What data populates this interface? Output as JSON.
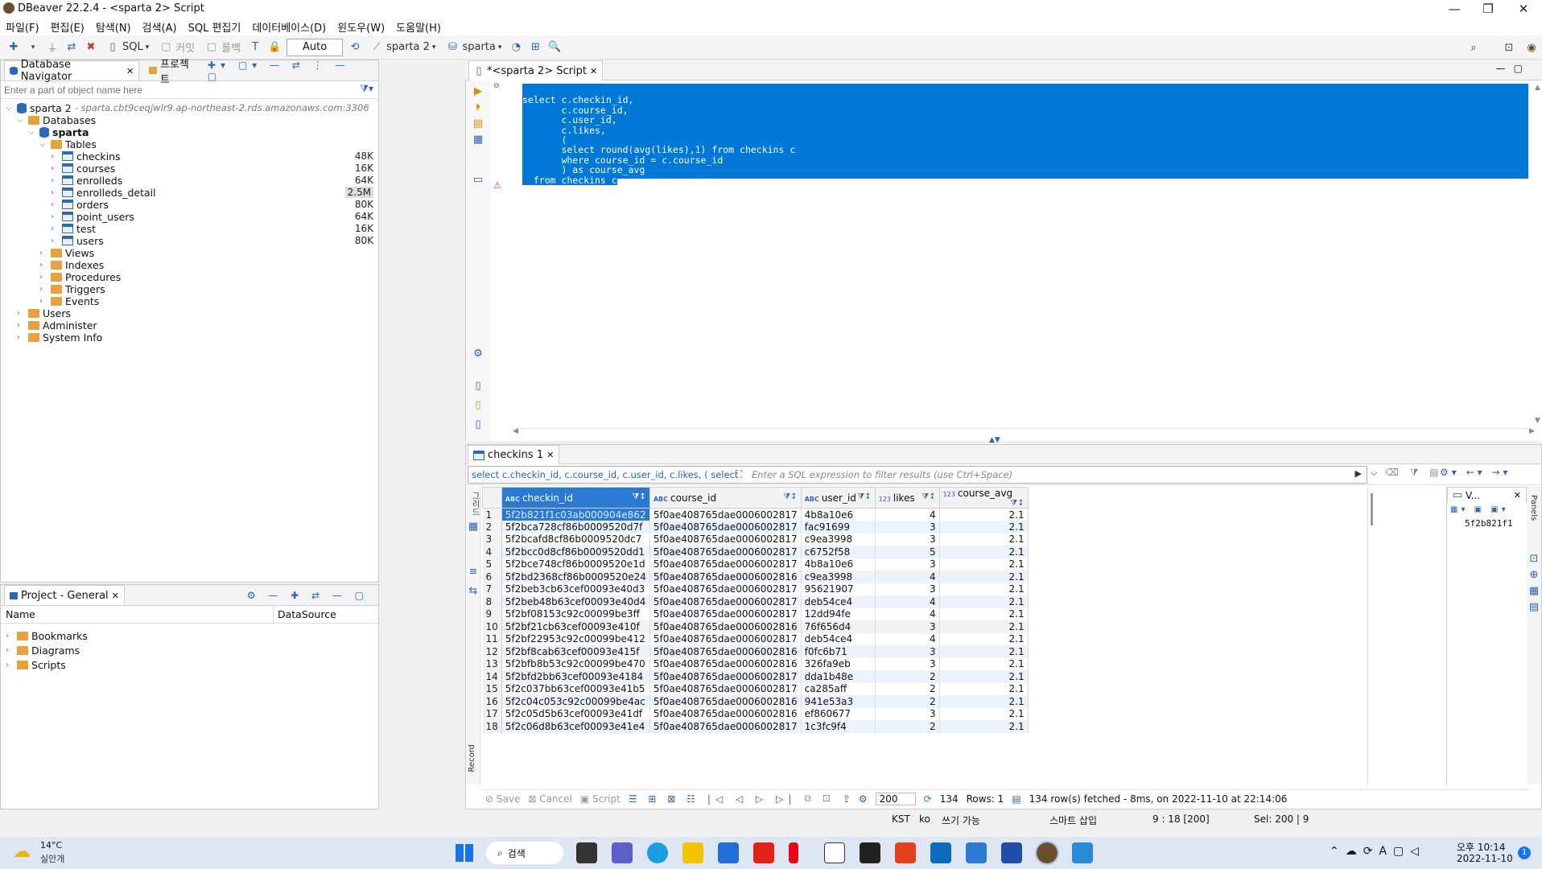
{
  "window": {
    "title": "DBeaver 22.2.4 - <sparta 2> Script"
  },
  "menu": [
    "파일(F)",
    "편집(E)",
    "탐색(N)",
    "검색(A)",
    "SQL 편집기",
    "데이터베이스(D)",
    "윈도우(W)",
    "도움말(H)"
  ],
  "toolbar": {
    "sql": "SQL",
    "commit": "커밋",
    "rollback": "롤백",
    "mode": "Auto",
    "connection": "sparta 2",
    "schema": "sparta"
  },
  "navigator": {
    "tab": "Database Navigator",
    "tab2": "프로젝트",
    "filter_placeholder": "Enter a part of object name here",
    "connection": "sparta 2",
    "connection_host": " - sparta.cbt9ceqjwlr9.ap-northeast-2.rds.amazonaws.com:3306",
    "databases": "Databases",
    "schema": "sparta",
    "tables_label": "Tables",
    "tables": [
      {
        "name": "checkins",
        "size": "48K"
      },
      {
        "name": "courses",
        "size": "16K"
      },
      {
        "name": "enrolleds",
        "size": "64K"
      },
      {
        "name": "enrolleds_detail",
        "size": "2.5M"
      },
      {
        "name": "orders",
        "size": "80K"
      },
      {
        "name": "point_users",
        "size": "64K"
      },
      {
        "name": "test",
        "size": "16K"
      },
      {
        "name": "users",
        "size": "80K"
      }
    ],
    "folders": [
      "Views",
      "Indexes",
      "Procedures",
      "Triggers",
      "Events"
    ],
    "root_items": [
      "Users",
      "Administer",
      "System Info"
    ]
  },
  "project": {
    "tab": "Project - General",
    "col_name": "Name",
    "col_ds": "DataSource",
    "items": [
      "Bookmarks",
      "Diagrams",
      "Scripts"
    ]
  },
  "editor": {
    "tab": "*<sparta 2> Script",
    "lines": [
      "select c.checkin_id,",
      "       c.course_id,",
      "       c.user_id,",
      "       c.likes,",
      "       (",
      "       select round(avg(likes),1) from checkins c",
      "       where course_id = c.course_id",
      "       ) as course_avg",
      "  from checkins c"
    ]
  },
  "results": {
    "tab": "checkins 1",
    "query_text": "select c.checkin_id, c.course_id, c.user_id, c.likes, ( select",
    "filter_placeholder": "Enter a SQL expression to filter results (use Ctrl+Space)",
    "columns": [
      {
        "type": "ABC",
        "name": "checkin_id"
      },
      {
        "type": "ABC",
        "name": "course_id"
      },
      {
        "type": "ABC",
        "name": "user_id"
      },
      {
        "type": "123",
        "name": "likes"
      },
      {
        "type": "123",
        "name": "course_avg"
      }
    ],
    "rows": [
      [
        "1",
        "5f2b821f1c03ab000904e862",
        "5f0ae408765dae0006002817",
        "4b8a10e6",
        "4",
        "2.1"
      ],
      [
        "2",
        "5f2bca728cf86b0009520d7f",
        "5f0ae408765dae0006002817",
        "fac91699",
        "3",
        "2.1"
      ],
      [
        "3",
        "5f2bcafd8cf86b0009520dc7",
        "5f0ae408765dae0006002817",
        "c9ea3998",
        "3",
        "2.1"
      ],
      [
        "4",
        "5f2bcc0d8cf86b0009520dd1",
        "5f0ae408765dae0006002817",
        "c6752f58",
        "5",
        "2.1"
      ],
      [
        "5",
        "5f2bce748cf86b0009520e1d",
        "5f0ae408765dae0006002817",
        "4b8a10e6",
        "3",
        "2.1"
      ],
      [
        "6",
        "5f2bd2368cf86b0009520e24",
        "5f0ae408765dae0006002816",
        "c9ea3998",
        "4",
        "2.1"
      ],
      [
        "7",
        "5f2beb3cb63cef00093e40d3",
        "5f0ae408765dae0006002817",
        "95621907",
        "3",
        "2.1"
      ],
      [
        "8",
        "5f2beb48b63cef00093e40d4",
        "5f0ae408765dae0006002817",
        "deb54ce4",
        "4",
        "2.1"
      ],
      [
        "9",
        "5f2bf08153c92c00099be3ff",
        "5f0ae408765dae0006002817",
        "12dd94fe",
        "4",
        "2.1"
      ],
      [
        "10",
        "5f2bf21cb63cef00093e410f",
        "5f0ae408765dae0006002816",
        "76f656d4",
        "3",
        "2.1"
      ],
      [
        "11",
        "5f2bf22953c92c00099be412",
        "5f0ae408765dae0006002817",
        "deb54ce4",
        "4",
        "2.1"
      ],
      [
        "12",
        "5f2bf8cab63cef00093e415f",
        "5f0ae408765dae0006002816",
        "f0fc6b71",
        "3",
        "2.1"
      ],
      [
        "13",
        "5f2bfb8b53c92c00099be470",
        "5f0ae408765dae0006002816",
        "326fa9eb",
        "3",
        "2.1"
      ],
      [
        "14",
        "5f2bfd2bb63cef00093e4184",
        "5f0ae408765dae0006002817",
        "dda1b48e",
        "2",
        "2.1"
      ],
      [
        "15",
        "5f2c037bb63cef00093e41b5",
        "5f0ae408765dae0006002817",
        "ca285aff",
        "2",
        "2.1"
      ],
      [
        "16",
        "5f2c04c053c92c00099be4ac",
        "5f0ae408765dae0006002816",
        "941e53a3",
        "2",
        "2.1"
      ],
      [
        "17",
        "5f2c05d5b63cef00093e41df",
        "5f0ae408765dae0006002816",
        "ef860677",
        "3",
        "2.1"
      ],
      [
        "18",
        "5f2c06d8b63cef00093e41e4",
        "5f0ae408765dae0006002817",
        "1c3fc9f4",
        "2",
        "2.1"
      ]
    ],
    "side_label": "그리드",
    "record_label": "Record",
    "value_panel_tab": "V...",
    "value_preview": "5f2b821f1",
    "panels_label": "Panels",
    "bottom": {
      "save": "Save",
      "cancel": "Cancel",
      "script": "Script",
      "fetch_size": "200",
      "count": "134",
      "rows": "Rows: 1",
      "status": "134 row(s) fetched - 8ms, on 2022-11-10 at 22:14:06"
    }
  },
  "statusbar": {
    "tz": "KST",
    "locale": "ko",
    "write": "쓰기 가능",
    "insert": "스마트 삽입",
    "pos": "9 : 18 [200]",
    "sel": "Sel: 200 | 9"
  },
  "taskbar": {
    "weather_temp": "14°C",
    "weather_desc": "실안개",
    "search": "검색",
    "time": "오후 10:14",
    "date": "2022-11-10",
    "notif": "1"
  }
}
